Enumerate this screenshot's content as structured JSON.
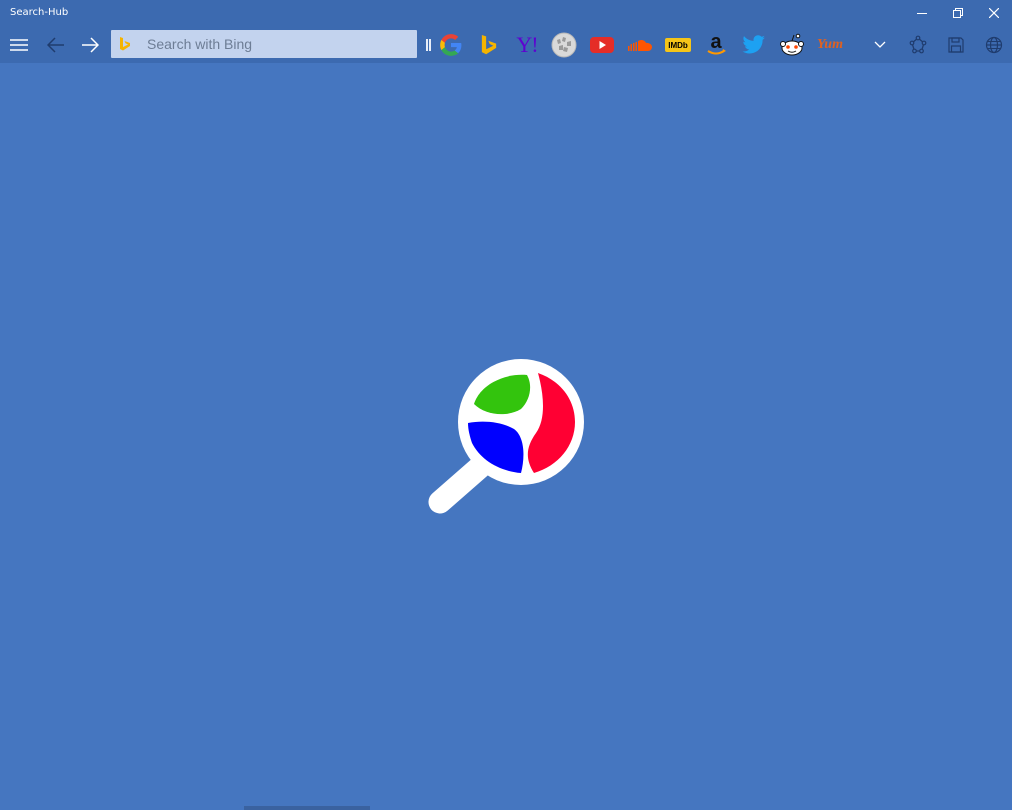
{
  "window": {
    "title": "Search-Hub"
  },
  "search": {
    "placeholder": "Search with Bing",
    "value": ""
  },
  "engines": [
    {
      "name": "Google",
      "icon": "google-icon"
    },
    {
      "name": "Bing",
      "icon": "bing-icon"
    },
    {
      "name": "Yahoo",
      "icon": "yahoo-icon",
      "glyph": "Y!"
    },
    {
      "name": "Wikipedia",
      "icon": "wikipedia-icon"
    },
    {
      "name": "YouTube",
      "icon": "youtube-icon"
    },
    {
      "name": "SoundCloud",
      "icon": "soundcloud-icon"
    },
    {
      "name": "IMDb",
      "icon": "imdb-icon",
      "glyph": "IMDb"
    },
    {
      "name": "Amazon",
      "icon": "amazon-icon",
      "glyph": "a"
    },
    {
      "name": "Twitter",
      "icon": "twitter-icon"
    },
    {
      "name": "Reddit",
      "icon": "reddit-icon"
    },
    {
      "name": "Yummly",
      "icon": "yummly-icon",
      "glyph": "Yum"
    }
  ],
  "colors": {
    "background": "#4576c0",
    "toolbar": "#3c6ab0",
    "search_box": "#c3d3ee",
    "logo_green": "#33c40d",
    "logo_red": "#ff0033",
    "logo_blue": "#0000ff"
  }
}
